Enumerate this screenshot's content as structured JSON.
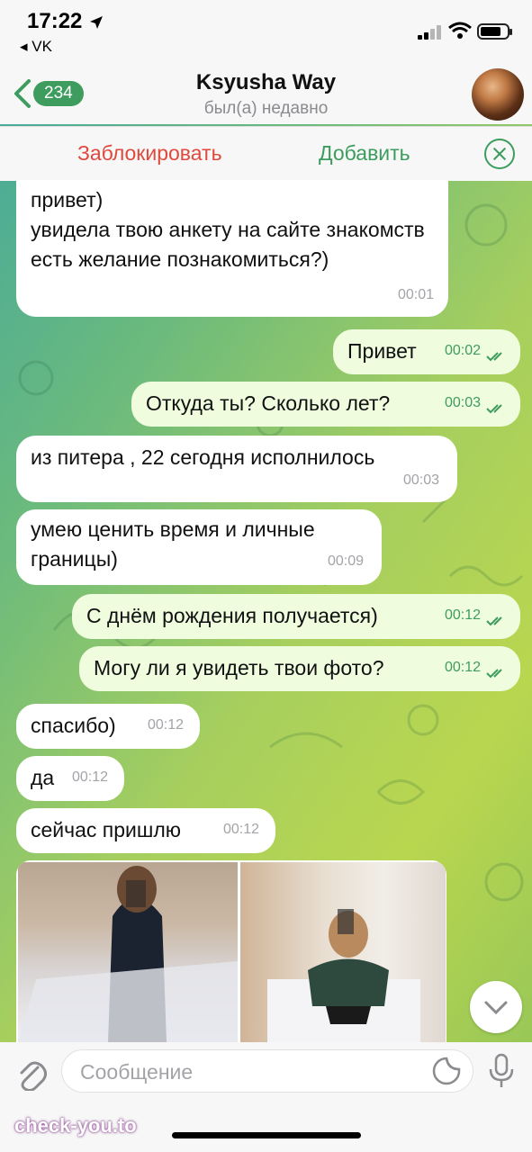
{
  "status_bar": {
    "time": "17:22",
    "back_app": "◂ VK"
  },
  "header": {
    "unread_count": "234",
    "contact_name": "Ksyusha Way",
    "contact_status": "был(а) недавно"
  },
  "actions": {
    "block_label": "Заблокировать",
    "add_label": "Добавить"
  },
  "messages": [
    {
      "dir": "in",
      "text": "привет)\nувидела твою анкету на сайте знакомств\nесть желание познакомиться?)",
      "time": "00:01"
    },
    {
      "dir": "out",
      "text": "Привет",
      "time": "00:02"
    },
    {
      "dir": "out",
      "text": "Откуда ты? Сколько лет?",
      "time": "00:03"
    },
    {
      "dir": "in",
      "text": "из питера , 22 сегодня исполнилось",
      "time": "00:03"
    },
    {
      "dir": "in",
      "text": "умею ценить время и личные\nграницы)",
      "time": "00:09"
    },
    {
      "dir": "out",
      "text": "С днём рождения получается)",
      "time": "00:12"
    },
    {
      "dir": "out",
      "text": "Могу ли я увидеть твои фото?",
      "time": "00:12"
    },
    {
      "dir": "in",
      "text": "спасибо)",
      "time": "00:12"
    },
    {
      "dir": "in",
      "text": "да",
      "time": "00:12"
    },
    {
      "dir": "in",
      "text": "сейчас пришлю",
      "time": "00:12"
    }
  ],
  "input": {
    "placeholder": "Сообщение"
  },
  "watermark": "check-you.to",
  "colors": {
    "accent": "#3e9c5e",
    "danger": "#e0493e",
    "outgoing_bubble": "#effdde"
  }
}
